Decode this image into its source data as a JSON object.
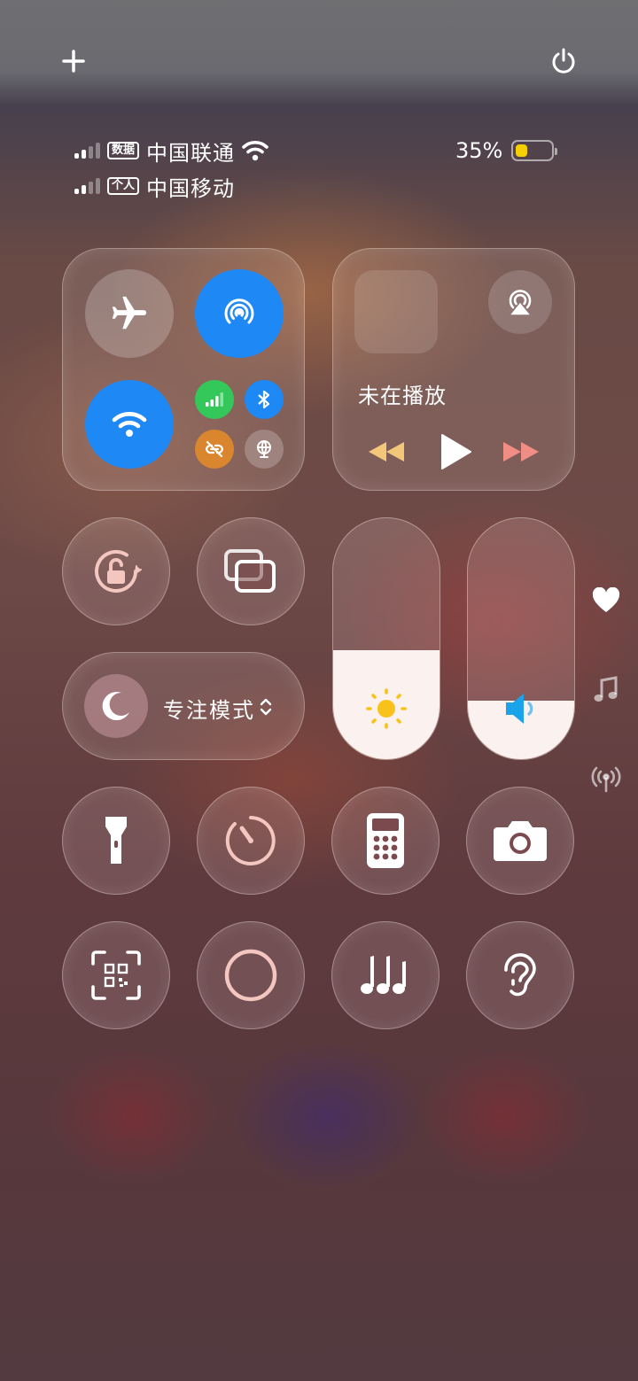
{
  "top": {
    "add_icon": "plus-icon",
    "power_icon": "power-icon"
  },
  "status": {
    "carriers": [
      {
        "tag": "数据",
        "name": "中国联通",
        "signal_bars": 2,
        "wifi": true
      },
      {
        "tag": "个人",
        "name": "中国移动",
        "signal_bars": 2,
        "wifi": false
      }
    ],
    "battery_text": "35%",
    "battery_level": 0.35,
    "battery_color": "#f5d000"
  },
  "connectivity": {
    "airplane": {
      "icon": "airplane-icon",
      "on": false
    },
    "airdrop": {
      "icon": "airdrop-icon",
      "on": true
    },
    "wifi": {
      "icon": "wifi-icon",
      "on": true
    },
    "cellular": {
      "icon": "cellular-icon",
      "on": true,
      "color": "#34c759"
    },
    "bluetooth": {
      "icon": "bluetooth-icon",
      "on": true,
      "color": "#1e88f5"
    },
    "hotspot": {
      "icon": "link-icon",
      "on": false,
      "color": "#d9862f"
    },
    "vpn": {
      "icon": "globe-icon",
      "on": false
    },
    "accent": "#1e88f5"
  },
  "media": {
    "status": "未在播放",
    "airplay_icon": "airplay-icon",
    "rewind_icon": "rewind-icon",
    "play_icon": "play-icon",
    "forward_icon": "fast-forward-icon"
  },
  "controls": {
    "rotation_lock_icon": "rotation-lock-icon",
    "screen_mirror_icon": "screen-mirroring-icon",
    "focus": {
      "icon": "moon-icon",
      "label": "专注模式",
      "chevron_icon": "chevron-updown-icon"
    },
    "brightness": {
      "icon": "sun-icon",
      "level": 0.45
    },
    "volume": {
      "icon": "speaker-icon",
      "level": 0.24
    },
    "row3": [
      "flashlight-icon",
      "timer-icon",
      "calculator-icon",
      "camera-icon"
    ],
    "row4": [
      "qr-code-icon",
      "screen-record-icon",
      "music-recognition-icon",
      "hearing-icon"
    ]
  },
  "side": [
    "heart-icon",
    "music-note-icon",
    "antenna-icon"
  ]
}
